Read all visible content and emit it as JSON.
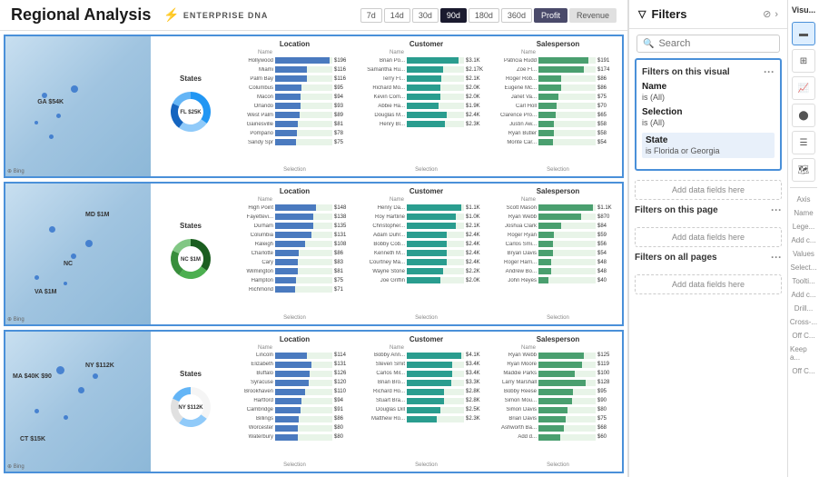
{
  "header": {
    "title": "Regional Analysis",
    "enterprise_dna_text": "ENTERPRISE DNA",
    "time_buttons": [
      "7d",
      "14d",
      "30d",
      "90d",
      "180d",
      "360d"
    ],
    "active_time": "90d",
    "profit_label": "Profit",
    "revenue_label": "Revenue"
  },
  "filters_panel": {
    "title": "Filters",
    "search_placeholder": "Search",
    "filters_on_visual_label": "Filters on this visual",
    "filters_on_page_label": "Filters on this page",
    "filters_on_all_label": "Filters on all pages",
    "add_data_fields_label": "Add data fields here",
    "filter_items": [
      {
        "name": "Name",
        "value": "is (All)"
      },
      {
        "name": "Selection",
        "value": "is (All)"
      },
      {
        "name": "State",
        "value": "is Florida or Georgia",
        "highlighted": true
      }
    ]
  },
  "rows": [
    {
      "id": "row1",
      "map_labels": [
        {
          "text": "GA $54K",
          "x": 22,
          "y": 45
        }
      ],
      "donut": {
        "label": "FL $25K",
        "legend": ""
      },
      "location_bars": [
        {
          "name": "Hollywood",
          "value": "$196",
          "pct": 95
        },
        {
          "name": "Miami",
          "value": "$116",
          "pct": 56
        },
        {
          "name": "Palm Bay",
          "value": "$116",
          "pct": 56
        },
        {
          "name": "Columbus",
          "value": "$95",
          "pct": 46
        },
        {
          "name": "Macon",
          "value": "$94",
          "pct": 45
        },
        {
          "name": "Orlando",
          "value": "$93",
          "pct": 45
        },
        {
          "name": "West Palm",
          "value": "$89",
          "pct": 43
        },
        {
          "name": "Gainesville",
          "value": "$81",
          "pct": 39
        },
        {
          "name": "Pompano",
          "value": "$78",
          "pct": 38
        },
        {
          "name": "Sandy Spr",
          "value": "$75",
          "pct": 36
        }
      ],
      "customer_bars": [
        {
          "name": "Brian Po...",
          "value": "$3.1K",
          "pct": 90
        },
        {
          "name": "Samantha Ru...",
          "value": "$2.17K",
          "pct": 63
        },
        {
          "name": "Terry Fl...",
          "value": "$2.1K",
          "pct": 61
        },
        {
          "name": "Richard Mo...",
          "value": "$2.0K",
          "pct": 58
        },
        {
          "name": "Kevin Com...",
          "value": "$2.0K",
          "pct": 58
        },
        {
          "name": "Abbie Ha...",
          "value": "$1.9K",
          "pct": 55
        },
        {
          "name": "Douglas M...",
          "value": "$2.4K",
          "pct": 70
        },
        {
          "name": "Henry Bl...",
          "value": "$2.3K",
          "pct": 67
        }
      ],
      "salesperson_bars": [
        {
          "name": "Patricia Rudd",
          "value": "$191",
          "pct": 88
        },
        {
          "name": "Zoe Fl...",
          "value": "$174",
          "pct": 80
        },
        {
          "name": "Roger Rob...",
          "value": "$86",
          "pct": 40
        },
        {
          "name": "Eugene Mc...",
          "value": "$86",
          "pct": 40
        },
        {
          "name": "Janet Va...",
          "value": "$75",
          "pct": 35
        },
        {
          "name": "Carl Holl",
          "value": "$70",
          "pct": 32
        },
        {
          "name": "Clarence Pro...",
          "value": "$65",
          "pct": 30
        },
        {
          "name": "Justin Aw...",
          "value": "$58",
          "pct": 27
        },
        {
          "name": "Ryan Butler",
          "value": "$58",
          "pct": 27
        },
        {
          "name": "Monte Car...",
          "value": "$54",
          "pct": 25
        }
      ]
    },
    {
      "id": "row2",
      "map_labels": [
        {
          "text": "MD $1M",
          "x": 55,
          "y": 20
        },
        {
          "text": "NC",
          "x": 40,
          "y": 55
        },
        {
          "text": "VA $1M",
          "x": 20,
          "y": 75
        }
      ],
      "donut": {
        "label": "NC $1M",
        "legend": ""
      },
      "location_bars": [
        {
          "name": "High Point",
          "value": "$148",
          "pct": 72
        },
        {
          "name": "Fayettevi...",
          "value": "$138",
          "pct": 67
        },
        {
          "name": "Durham",
          "value": "$135",
          "pct": 66
        },
        {
          "name": "Columbia",
          "value": "$131",
          "pct": 64
        },
        {
          "name": "Raleigh",
          "value": "$108",
          "pct": 53
        },
        {
          "name": "Charlotte",
          "value": "$86",
          "pct": 42
        },
        {
          "name": "Cary",
          "value": "$83",
          "pct": 40
        },
        {
          "name": "Wilmington",
          "value": "$81",
          "pct": 39
        },
        {
          "name": "Hampton",
          "value": "$75",
          "pct": 37
        },
        {
          "name": "Richmond",
          "value": "$71",
          "pct": 35
        }
      ],
      "customer_bars": [
        {
          "name": "Henry Da...",
          "value": "$1.1K",
          "pct": 95
        },
        {
          "name": "Roy Hartline",
          "value": "$1.0K",
          "pct": 86
        },
        {
          "name": "Christopher...",
          "value": "$2.1K",
          "pct": 85
        },
        {
          "name": "Adam Duhr...",
          "value": "$2.4K",
          "pct": 70
        },
        {
          "name": "Bobby Cob...",
          "value": "$2.4K",
          "pct": 70
        },
        {
          "name": "Kenneth M...",
          "value": "$2.4K",
          "pct": 70
        },
        {
          "name": "Courtney Ma...",
          "value": "$2.4K",
          "pct": 70
        },
        {
          "name": "Wayne Stone",
          "value": "$2.2K",
          "pct": 64
        },
        {
          "name": "Joe Griffin",
          "value": "$2.0K",
          "pct": 58
        }
      ],
      "salesperson_bars": [
        {
          "name": "Scott Mason",
          "value": "$1.1K",
          "pct": 95
        },
        {
          "name": "Ryan Webb",
          "value": "$870",
          "pct": 75
        },
        {
          "name": "Joshua Clark",
          "value": "$84",
          "pct": 39
        },
        {
          "name": "Roger Ryan",
          "value": "$59",
          "pct": 27
        },
        {
          "name": "Carlos Smi...",
          "value": "$56",
          "pct": 26
        },
        {
          "name": "Bryan Davis",
          "value": "$54",
          "pct": 25
        },
        {
          "name": "Roger Harri...",
          "value": "$48",
          "pct": 22
        },
        {
          "name": "Andrew Bo...",
          "value": "$48",
          "pct": 22
        },
        {
          "name": "John Reyes",
          "value": "$40",
          "pct": 18
        }
      ]
    },
    {
      "id": "row3",
      "map_labels": [
        {
          "text": "MA $40K $90",
          "x": 5,
          "y": 30
        },
        {
          "text": "NY $112K",
          "x": 55,
          "y": 22
        },
        {
          "text": "CT $15K",
          "x": 10,
          "y": 75
        }
      ],
      "donut": {
        "label": "NY $112K",
        "legend": ""
      },
      "location_bars": [
        {
          "name": "Lincoln",
          "value": "$114",
          "pct": 55
        },
        {
          "name": "Elizabeth",
          "value": "$131",
          "pct": 64
        },
        {
          "name": "Buffalo",
          "value": "$126",
          "pct": 61
        },
        {
          "name": "Syracuse",
          "value": "$120",
          "pct": 58
        },
        {
          "name": "Brookhaven",
          "value": "$110",
          "pct": 53
        },
        {
          "name": "Hartford",
          "value": "$94",
          "pct": 46
        },
        {
          "name": "Cambridge",
          "value": "$91",
          "pct": 44
        },
        {
          "name": "Billings",
          "value": "$86",
          "pct": 42
        },
        {
          "name": "Worcester",
          "value": "$80",
          "pct": 39
        },
        {
          "name": "Waterbury",
          "value": "$80",
          "pct": 39
        }
      ],
      "customer_bars": [
        {
          "name": "Bobby Ann...",
          "value": "$4.1K",
          "pct": 95
        },
        {
          "name": "Steven Smit",
          "value": "$3.4K",
          "pct": 79
        },
        {
          "name": "Carlos Mil...",
          "value": "$3.4K",
          "pct": 79
        },
        {
          "name": "Brian Bro...",
          "value": "$3.3K",
          "pct": 77
        },
        {
          "name": "Richard Ho...",
          "value": "$2.8K",
          "pct": 65
        },
        {
          "name": "Stuart Bra...",
          "value": "$2.8K",
          "pct": 65
        },
        {
          "name": "Douglas Dill",
          "value": "$2.5K",
          "pct": 58
        },
        {
          "name": "Matthew Ro...",
          "value": "$2.3K",
          "pct": 53
        }
      ],
      "salesperson_bars": [
        {
          "name": "Ryan Webb",
          "value": "$125",
          "pct": 80
        },
        {
          "name": "Ryan Moore",
          "value": "$119",
          "pct": 76
        },
        {
          "name": "Maddie Parks",
          "value": "$100",
          "pct": 64
        },
        {
          "name": "Larry Marshall",
          "value": "$128",
          "pct": 82
        },
        {
          "name": "Bobby Reese",
          "value": "$95",
          "pct": 61
        },
        {
          "name": "Simon Mou...",
          "value": "$90",
          "pct": 58
        },
        {
          "name": "Simon Davis",
          "value": "$80",
          "pct": 51
        },
        {
          "name": "Brian Davis",
          "value": "$75",
          "pct": 48
        },
        {
          "name": "Ashworth Ba...",
          "value": "$68",
          "pct": 44
        },
        {
          "name": "Add d...",
          "value": "$60",
          "pct": 38
        }
      ]
    }
  ],
  "visual_panel": {
    "title": "Visu...",
    "icons": [
      "☰",
      "📊",
      "🔲",
      "⊞",
      "≡",
      "🗂",
      "⊡"
    ]
  }
}
